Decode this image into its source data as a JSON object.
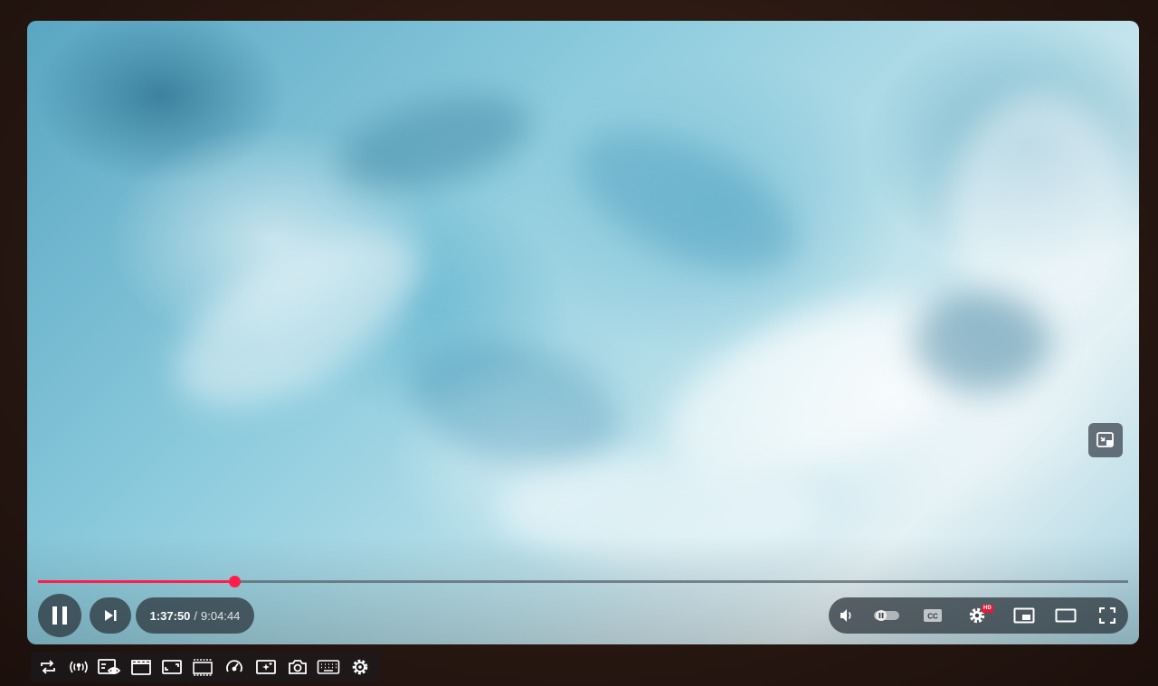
{
  "player": {
    "time_current": "1:37:50",
    "time_separator": "/",
    "time_total": "9:04:44",
    "progress_fraction": 0.18,
    "hd_badge": "HD",
    "progress_color": "#ff1e4a",
    "icons": {
      "miniplayer_overlay": "miniplayer-icon",
      "pause": "pause-icon",
      "next": "skip-next-icon",
      "volume": "volume-icon",
      "autoplay": "autoplay-toggle-icon",
      "captions": "cc-icon",
      "settings": "gear-icon",
      "miniplayer": "miniplayer-icon",
      "theater": "theater-mode-icon",
      "fullscreen": "fullscreen-icon"
    }
  },
  "toolbar": {
    "icons": [
      "loop-icon",
      "broadcast-icon",
      "watch-mode-icon",
      "clapperboard-icon",
      "aspect-ratio-icon",
      "frame-icon",
      "speedometer-icon",
      "enhance-icon",
      "camera-icon",
      "keyboard-icon",
      "gear-icon"
    ]
  }
}
